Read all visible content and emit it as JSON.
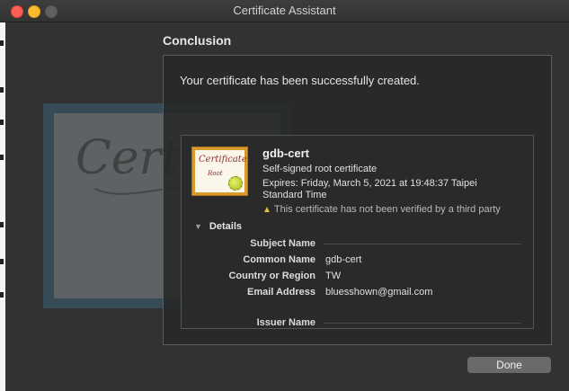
{
  "window": {
    "title": "Certificate Assistant"
  },
  "illustration": {
    "text": "Certif"
  },
  "page": {
    "heading": "Conclusion",
    "message": "Your certificate has been successfully created."
  },
  "certificate": {
    "icon_word": "Certificate",
    "icon_sub": "Root",
    "name": "gdb-cert",
    "type": "Self-signed root certificate",
    "expires_line1": "Expires: Friday, March 5, 2021 at 19:48:37 Taipei",
    "expires_line2": "Standard Time",
    "warning": "This certificate has not been verified by a third party",
    "details_label": "Details",
    "subject_heading": "Subject Name",
    "fields": [
      {
        "label": "Common Name",
        "value": "gdb-cert"
      },
      {
        "label": "Country or Region",
        "value": "TW"
      },
      {
        "label": "Email Address",
        "value": "bluesshown@gmail.com"
      }
    ],
    "issuer_heading": "Issuer Name"
  },
  "buttons": {
    "done": "Done"
  },
  "colors": {
    "close": "#fd5f57",
    "minimize": "#febc2e",
    "warning": "#e6c233"
  }
}
